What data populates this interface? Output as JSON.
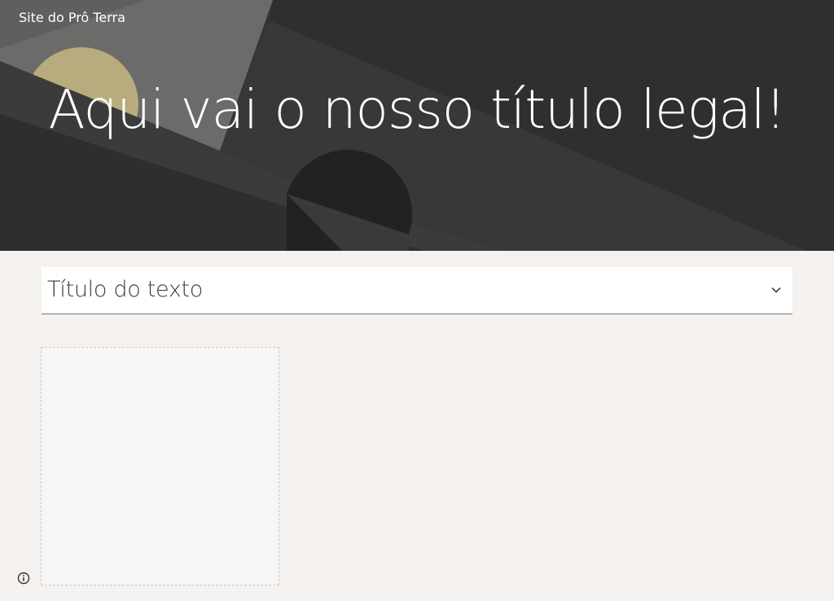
{
  "header": {
    "site_title": "Site do Prô Terra",
    "hero_title": "Aqui vai o nosso título legal!"
  },
  "section": {
    "title": "Título do texto",
    "expanded": false
  },
  "icons": {
    "chevron": "chevron-down-icon",
    "info": "info-icon"
  },
  "colors": {
    "hero_bg": "#353535",
    "page_bg": "#f4f1ee",
    "accent_gold": "#b8ac7e"
  }
}
